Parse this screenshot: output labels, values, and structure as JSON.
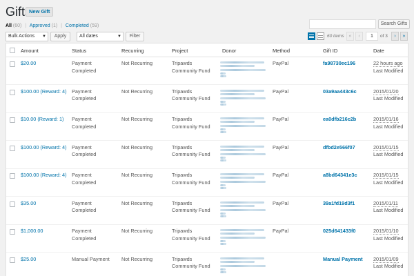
{
  "page": {
    "title": "Gifts",
    "new_button": "New Gift"
  },
  "filters": {
    "all": "All",
    "all_count": "(60)",
    "approved": "Approved",
    "approved_count": "(1)",
    "completed": "Completed",
    "completed_count": "(59)"
  },
  "search": {
    "placeholder": "",
    "button": "Search Gifts"
  },
  "tablenav": {
    "bulk_actions": "Bulk Actions",
    "apply": "Apply",
    "dates": "All dates",
    "filter": "Filter",
    "items": "60 items",
    "first": "«",
    "prev": "‹",
    "current_page": "1",
    "of_pages": "of 3",
    "next": "›",
    "last": "»"
  },
  "columns": [
    "Amount",
    "Status",
    "Recurring",
    "Project",
    "Donor",
    "Method",
    "Gift ID",
    "Date"
  ],
  "rows": [
    {
      "amount": "$20.00",
      "status1": "Payment",
      "status2": "Completed",
      "recurring": "Not Recurring",
      "project1": "Tripawds",
      "project2": "Community Fund",
      "method": "PayPal",
      "gift_id": "fa98730ec196",
      "date": "22 hours ago",
      "date_sub": "Last Modified"
    },
    {
      "amount": "$100.00 (Reward: 4)",
      "status1": "Payment",
      "status2": "Completed",
      "recurring": "Not Recurring",
      "project1": "Tripawds",
      "project2": "Community Fund",
      "method": "PayPal",
      "gift_id": "03a9aa443c6c",
      "date": "2015/01/20",
      "date_sub": "Last Modified"
    },
    {
      "amount": "$10.00 (Reward: 1)",
      "status1": "Payment",
      "status2": "Completed",
      "recurring": "Not Recurring",
      "project1": "Tripawds",
      "project2": "Community Fund",
      "method": "PayPal",
      "gift_id": "ea0dfb216c2b",
      "date": "2015/01/16",
      "date_sub": "Last Modified"
    },
    {
      "amount": "$100.00 (Reward: 4)",
      "status1": "Payment",
      "status2": "Completed",
      "recurring": "Not Recurring",
      "project1": "Tripawds",
      "project2": "Community Fund",
      "method": "PayPal",
      "gift_id": "dfbd2e566f07",
      "date": "2015/01/15",
      "date_sub": "Last Modified"
    },
    {
      "amount": "$100.00 (Reward: 4)",
      "status1": "Payment",
      "status2": "Completed",
      "recurring": "Not Recurring",
      "project1": "Tripawds",
      "project2": "Community Fund",
      "method": "PayPal",
      "gift_id": "a8bd64341e3c",
      "date": "2015/01/15",
      "date_sub": "Last Modified"
    },
    {
      "amount": "$35.00",
      "status1": "Payment",
      "status2": "Completed",
      "recurring": "Not Recurring",
      "project1": "Tripawds",
      "project2": "Community Fund",
      "method": "PayPal",
      "gift_id": "39a1fd19d3f1",
      "date": "2015/01/11",
      "date_sub": "Last Modified"
    },
    {
      "amount": "$1,000.00",
      "status1": "Payment",
      "status2": "Completed",
      "recurring": "Not Recurring",
      "project1": "Tripawds",
      "project2": "Community Fund",
      "method": "PayPal",
      "gift_id": "025d641433f0",
      "date": "2015/01/10",
      "date_sub": "Last Modified"
    },
    {
      "amount": "$25.00",
      "status1": "Manual Payment",
      "status2": "",
      "recurring": "Not Recurring",
      "project1": "Tripawds",
      "project2": "Community Fund",
      "method": "",
      "gift_id": "Manual Payment",
      "date": "2015/01/09",
      "date_sub": "Last Modified"
    }
  ],
  "colors": {
    "link": "#0073aa",
    "background": "#f1f1f1",
    "table_bg": "#ffffff"
  }
}
